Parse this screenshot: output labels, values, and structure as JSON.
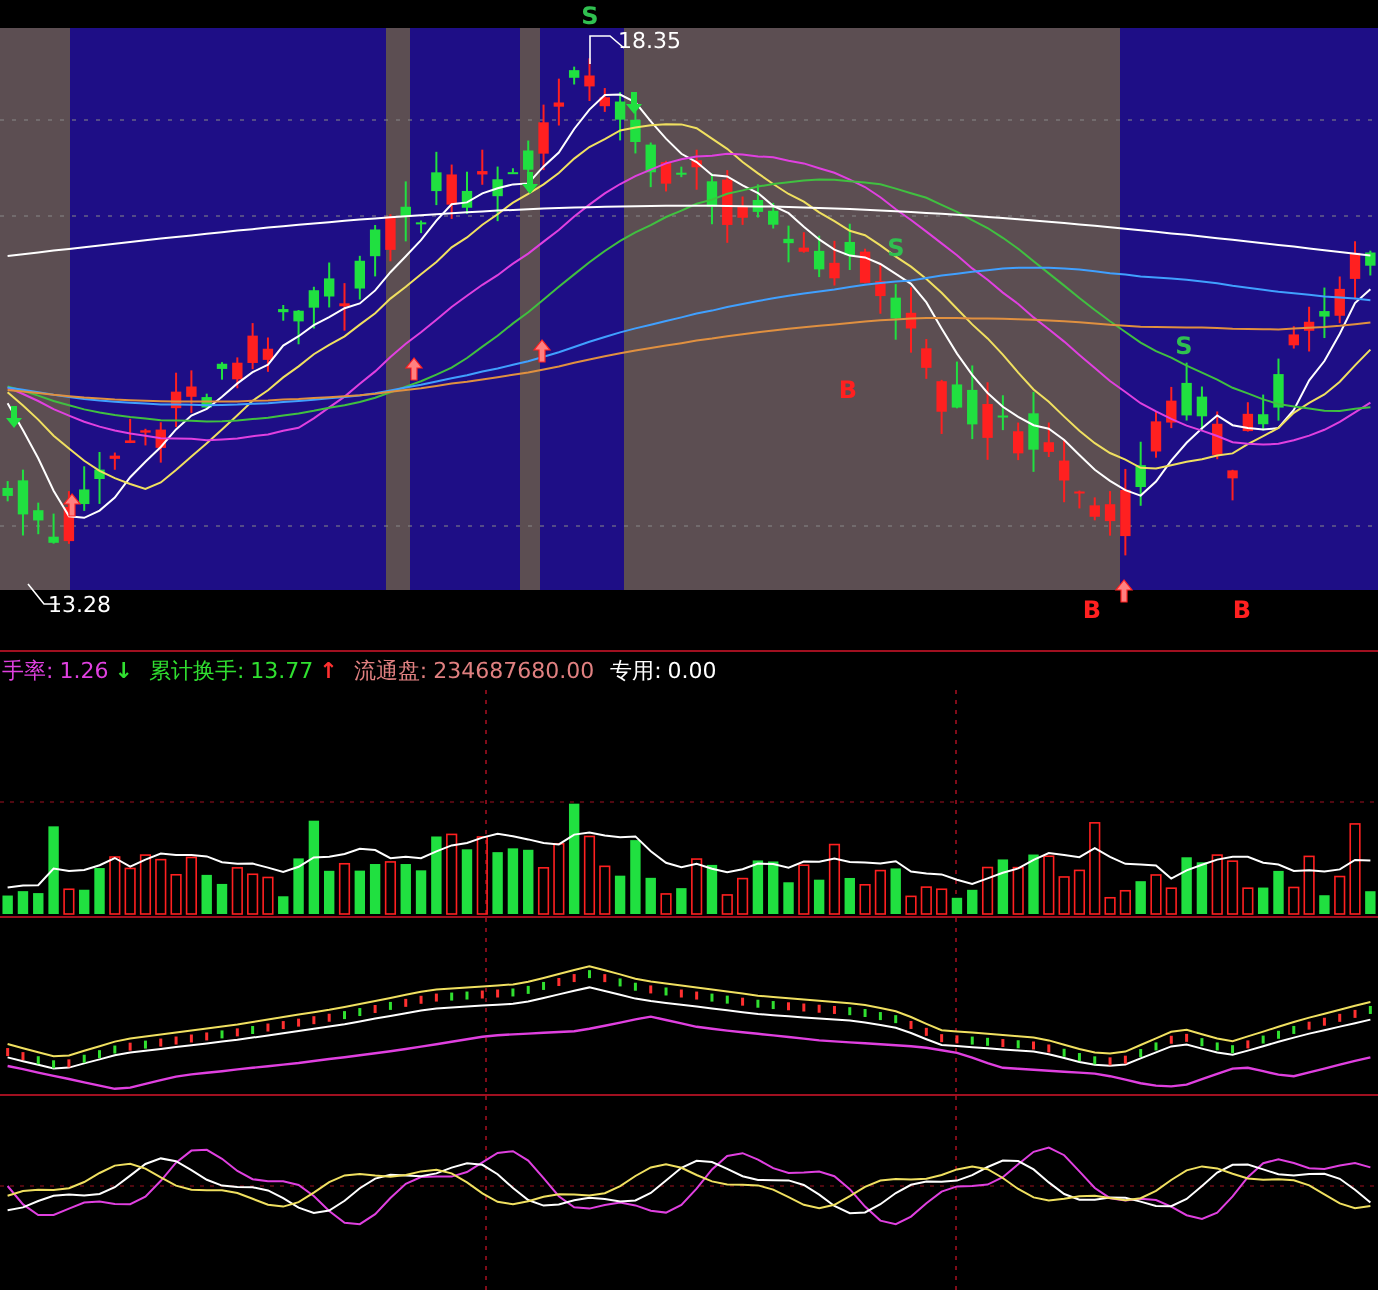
{
  "price_panel": {
    "signals": [
      {
        "kind": "sell",
        "text": "S"
      },
      {
        "kind": "sell",
        "text": "S"
      },
      {
        "kind": "sell",
        "text": "S"
      },
      {
        "kind": "buy",
        "text": "B"
      },
      {
        "kind": "buy",
        "text": "B"
      },
      {
        "kind": "buy",
        "text": "B"
      }
    ],
    "high_label": "18.35",
    "low_label": "13.28"
  },
  "indicator_bar": {
    "items": [
      {
        "kind": "falling",
        "label": "手率:",
        "value": "1.26",
        "arrow": "↓",
        "color": "#e040e0"
      },
      {
        "kind": "rising",
        "label": "累计换手:",
        "value": "13.77",
        "arrow": "↑",
        "color": "#30e030"
      },
      {
        "kind": "plain",
        "label": "流通盘:",
        "value": "234687680.00",
        "color": "#e08080"
      },
      {
        "kind": "plain",
        "label": "专用:",
        "value": "0.00",
        "color": "#ffffff"
      }
    ]
  }
}
